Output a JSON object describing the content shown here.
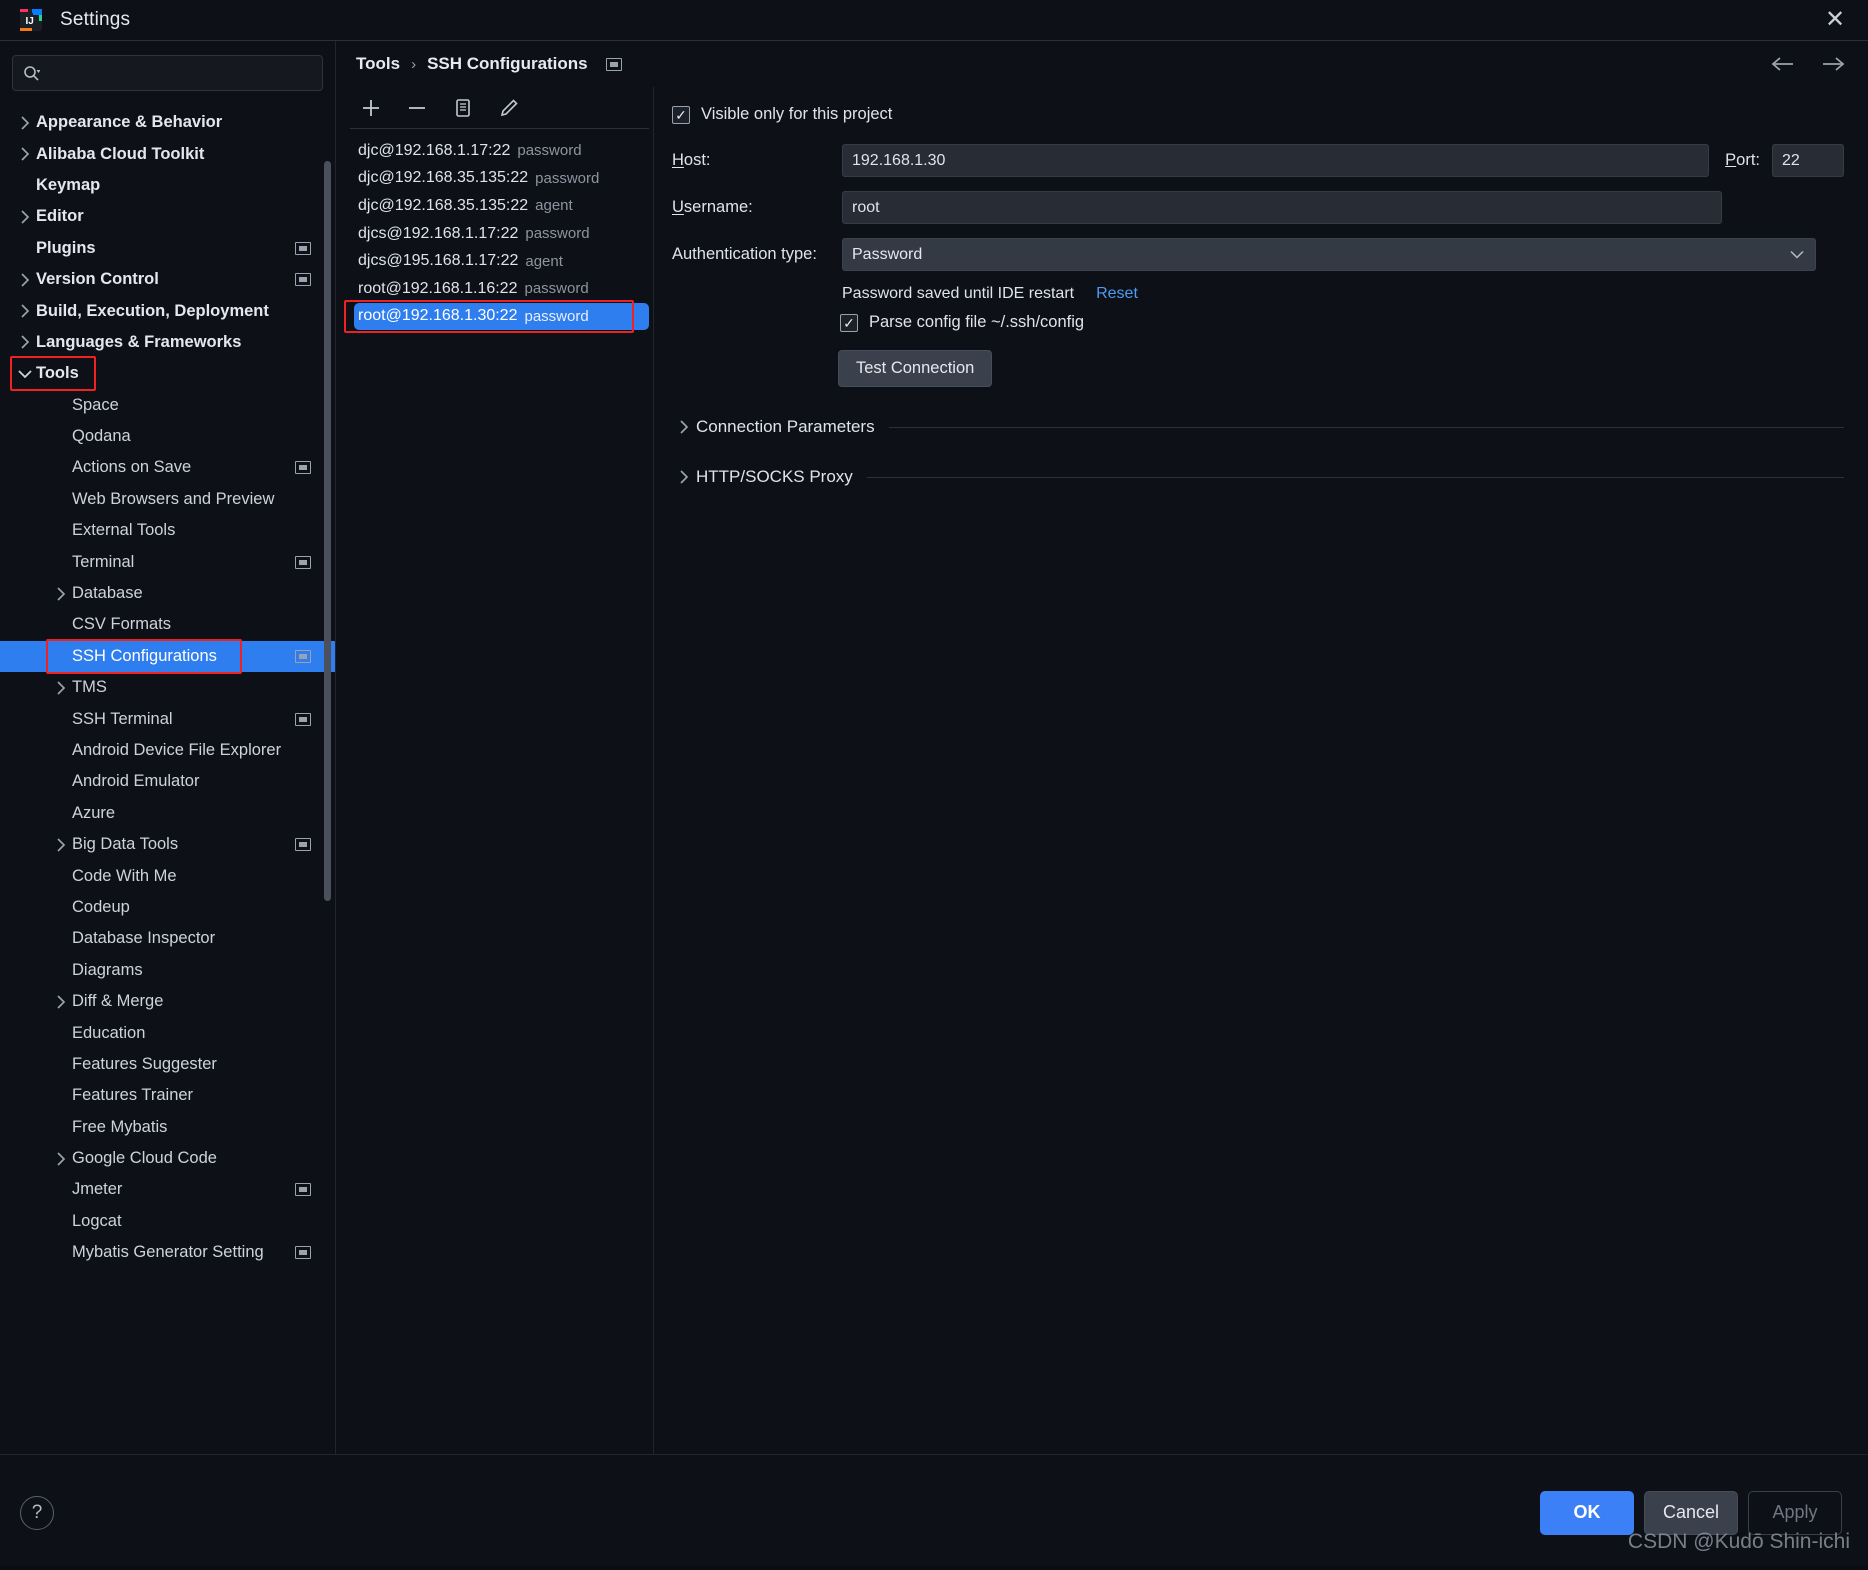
{
  "window": {
    "title": "Settings",
    "app_icon": "intellij-idea-icon",
    "close_label": "✕"
  },
  "search": {
    "placeholder": "",
    "value": "",
    "icon": "search-icon"
  },
  "sidebar": {
    "items": [
      {
        "label": "Appearance & Behavior",
        "arrow": "right",
        "bold": true,
        "indent": 0,
        "badge": false,
        "selected": false
      },
      {
        "label": "Alibaba Cloud Toolkit",
        "arrow": "right",
        "bold": true,
        "indent": 0,
        "badge": false,
        "selected": false
      },
      {
        "label": "Keymap",
        "arrow": "none",
        "bold": true,
        "indent": 0,
        "badge": false,
        "selected": false
      },
      {
        "label": "Editor",
        "arrow": "right",
        "bold": true,
        "indent": 0,
        "badge": false,
        "selected": false
      },
      {
        "label": "Plugins",
        "arrow": "none",
        "bold": true,
        "indent": 0,
        "badge": true,
        "selected": false
      },
      {
        "label": "Version Control",
        "arrow": "right",
        "bold": true,
        "indent": 0,
        "badge": true,
        "selected": false
      },
      {
        "label": "Build, Execution, Deployment",
        "arrow": "right",
        "bold": true,
        "indent": 0,
        "badge": false,
        "selected": false
      },
      {
        "label": "Languages & Frameworks",
        "arrow": "right",
        "bold": true,
        "indent": 0,
        "badge": false,
        "selected": false
      },
      {
        "label": "Tools",
        "arrow": "down",
        "bold": true,
        "indent": 0,
        "badge": false,
        "selected": false,
        "highlight": true
      },
      {
        "label": "Space",
        "arrow": "none",
        "bold": false,
        "indent": 1,
        "badge": false,
        "selected": false
      },
      {
        "label": "Qodana",
        "arrow": "none",
        "bold": false,
        "indent": 1,
        "badge": false,
        "selected": false
      },
      {
        "label": "Actions on Save",
        "arrow": "none",
        "bold": false,
        "indent": 1,
        "badge": true,
        "selected": false
      },
      {
        "label": "Web Browsers and Preview",
        "arrow": "none",
        "bold": false,
        "indent": 1,
        "badge": false,
        "selected": false
      },
      {
        "label": "External Tools",
        "arrow": "none",
        "bold": false,
        "indent": 1,
        "badge": false,
        "selected": false
      },
      {
        "label": "Terminal",
        "arrow": "none",
        "bold": false,
        "indent": 1,
        "badge": true,
        "selected": false
      },
      {
        "label": "Database",
        "arrow": "right",
        "bold": false,
        "indent": 1,
        "badge": false,
        "selected": false
      },
      {
        "label": "CSV Formats",
        "arrow": "none",
        "bold": false,
        "indent": 1,
        "badge": false,
        "selected": false
      },
      {
        "label": "SSH Configurations",
        "arrow": "none",
        "bold": false,
        "indent": 1,
        "badge": true,
        "selected": true,
        "highlight": true
      },
      {
        "label": "TMS",
        "arrow": "right",
        "bold": false,
        "indent": 1,
        "badge": false,
        "selected": false
      },
      {
        "label": "SSH Terminal",
        "arrow": "none",
        "bold": false,
        "indent": 1,
        "badge": true,
        "selected": false
      },
      {
        "label": "Android Device File Explorer",
        "arrow": "none",
        "bold": false,
        "indent": 1,
        "badge": false,
        "selected": false
      },
      {
        "label": "Android Emulator",
        "arrow": "none",
        "bold": false,
        "indent": 1,
        "badge": false,
        "selected": false
      },
      {
        "label": "Azure",
        "arrow": "none",
        "bold": false,
        "indent": 1,
        "badge": false,
        "selected": false
      },
      {
        "label": "Big Data Tools",
        "arrow": "right",
        "bold": false,
        "indent": 1,
        "badge": true,
        "selected": false
      },
      {
        "label": "Code With Me",
        "arrow": "none",
        "bold": false,
        "indent": 1,
        "badge": false,
        "selected": false
      },
      {
        "label": "Codeup",
        "arrow": "none",
        "bold": false,
        "indent": 1,
        "badge": false,
        "selected": false
      },
      {
        "label": "Database Inspector",
        "arrow": "none",
        "bold": false,
        "indent": 1,
        "badge": false,
        "selected": false
      },
      {
        "label": "Diagrams",
        "arrow": "none",
        "bold": false,
        "indent": 1,
        "badge": false,
        "selected": false
      },
      {
        "label": "Diff & Merge",
        "arrow": "right",
        "bold": false,
        "indent": 1,
        "badge": false,
        "selected": false
      },
      {
        "label": "Education",
        "arrow": "none",
        "bold": false,
        "indent": 1,
        "badge": false,
        "selected": false
      },
      {
        "label": "Features Suggester",
        "arrow": "none",
        "bold": false,
        "indent": 1,
        "badge": false,
        "selected": false
      },
      {
        "label": "Features Trainer",
        "arrow": "none",
        "bold": false,
        "indent": 1,
        "badge": false,
        "selected": false
      },
      {
        "label": "Free Mybatis",
        "arrow": "none",
        "bold": false,
        "indent": 1,
        "badge": false,
        "selected": false
      },
      {
        "label": "Google Cloud Code",
        "arrow": "right",
        "bold": false,
        "indent": 1,
        "badge": false,
        "selected": false
      },
      {
        "label": "Jmeter",
        "arrow": "none",
        "bold": false,
        "indent": 1,
        "badge": true,
        "selected": false
      },
      {
        "label": "Logcat",
        "arrow": "none",
        "bold": false,
        "indent": 1,
        "badge": false,
        "selected": false
      },
      {
        "label": "Mybatis Generator Setting",
        "arrow": "none",
        "bold": false,
        "indent": 1,
        "badge": true,
        "selected": false
      }
    ]
  },
  "breadcrumb": {
    "items": [
      "Tools",
      "SSH Configurations"
    ],
    "separator": "›",
    "trailing_icon": "settings-sync-icon",
    "back_icon": "arrow-left-icon",
    "forward_icon": "arrow-right-icon"
  },
  "config_list": {
    "toolbar": [
      {
        "name": "add-config-button",
        "icon": "plus-icon"
      },
      {
        "name": "remove-config-button",
        "icon": "minus-icon"
      },
      {
        "name": "copy-config-button",
        "icon": "copy-icon"
      },
      {
        "name": "edit-config-button",
        "icon": "pencil-icon"
      }
    ],
    "items": [
      {
        "name": "djc@192.168.1.17:22",
        "auth": "password",
        "selected": false
      },
      {
        "name": "djc@192.168.35.135:22",
        "auth": "password",
        "selected": false
      },
      {
        "name": "djc@192.168.35.135:22",
        "auth": "agent",
        "selected": false
      },
      {
        "name": "djcs@192.168.1.17:22",
        "auth": "password",
        "selected": false
      },
      {
        "name": "djcs@195.168.1.17:22",
        "auth": "agent",
        "selected": false
      },
      {
        "name": "root@192.168.1.16:22",
        "auth": "password",
        "selected": false
      },
      {
        "name": "root@192.168.1.30:22",
        "auth": "password",
        "selected": true,
        "highlight": true
      }
    ]
  },
  "form": {
    "visible_only_checkbox": {
      "label": "Visible only for this project",
      "checked": true
    },
    "host": {
      "label": "Host:",
      "label_mnemonic": "H",
      "value": "192.168.1.30"
    },
    "port": {
      "label": "Port:",
      "label_mnemonic": "P",
      "value": "22"
    },
    "username": {
      "label": "Username:",
      "label_mnemonic": "U",
      "value": "root"
    },
    "auth_type": {
      "label": "Authentication type:",
      "value": "Password",
      "caret": "chevron-down-icon"
    },
    "password_status": "Password saved until IDE restart",
    "reset_link": "Reset",
    "parse_config_checkbox": {
      "label": "Parse config file ~/.ssh/config",
      "checked": true
    },
    "test_connection_button": "Test Connection",
    "sections": [
      {
        "title": "Connection Parameters",
        "expanded": false
      },
      {
        "title": "HTTP/SOCKS Proxy",
        "expanded": false
      }
    ]
  },
  "footer": {
    "help_label": "?",
    "ok_label": "OK",
    "cancel_label": "Cancel",
    "apply_label": "Apply",
    "watermark": "CSDN @Kudō Shin-ichi"
  },
  "colors": {
    "accent": "#2f7ef0",
    "highlight_border": "#ef2222",
    "background": "#0d1117",
    "link": "#4d9bf5"
  }
}
